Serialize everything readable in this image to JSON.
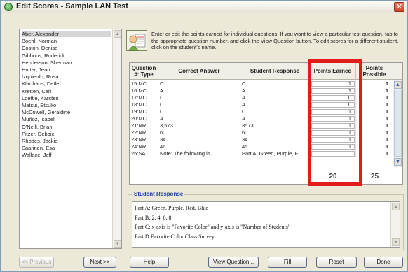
{
  "window": {
    "title": "Edit Scores - Sample LAN Test",
    "close_glyph": "✕"
  },
  "students": [
    "Aber, Alexander",
    "Boehl, Norman",
    "Coston, Denise",
    "Gibbons, Roderick",
    "Henderson, Sherman",
    "Hutter, Jean",
    "Izquierdo, Rosa",
    "Klarthaus, Detlef",
    "Kretten, Carl",
    "Loettle, Karsten",
    "Matsui, Etsuko",
    "McDowell, Geraldine",
    "Muñoz, Isabel",
    "O'Neill, Brian",
    "Pitzer, Debbie",
    "Rhodes, Jackie",
    "Saarinen, Esa",
    "Wallace, Jeff"
  ],
  "selected_student_index": 0,
  "instructions": "Enter or edit the points earned for individual questions. If you want to view a particular test question, tab to the appropriate question number, and click the View Question button. To edit scores for a different student, click on the student's name.",
  "table": {
    "headers": {
      "question": "Question #: Type",
      "correct": "Correct Answer",
      "student": "Student Response",
      "earned": "Points Earned",
      "possible": "Points Possible"
    },
    "rows": [
      {
        "q": "15:MC",
        "correct": "C",
        "student": "C",
        "earned": "1",
        "possible": "1"
      },
      {
        "q": "16:MC",
        "correct": "A",
        "student": "A",
        "earned": "1",
        "possible": "1"
      },
      {
        "q": "17:MC",
        "correct": "D",
        "student": "A",
        "earned": "0",
        "possible": "1"
      },
      {
        "q": "18:MC",
        "correct": "C",
        "student": "A",
        "earned": "0",
        "possible": "1"
      },
      {
        "q": "19:MC",
        "correct": "C",
        "student": "C",
        "earned": "1",
        "possible": "1"
      },
      {
        "q": "20:MC",
        "correct": "A",
        "student": "A",
        "earned": "1",
        "possible": "1"
      },
      {
        "q": "21:NR",
        "correct": "3,573",
        "student": "3573",
        "earned": "1",
        "possible": "1"
      },
      {
        "q": "22:NR",
        "correct": "60",
        "student": "60",
        "earned": "1",
        "possible": "1"
      },
      {
        "q": "23:NR",
        "correct": "34",
        "student": "34",
        "earned": "1",
        "possible": "1"
      },
      {
        "q": "24:NR",
        "correct": "46",
        "student": "45",
        "earned": "1",
        "possible": "1"
      },
      {
        "q": "25:SA",
        "correct": "Note: The following is ...",
        "student": "Part A: Green, Purple, F",
        "earned": "",
        "possible": "1"
      }
    ],
    "total_earned": "20",
    "total_possible": "25"
  },
  "student_response": {
    "title": "Student Response",
    "lines": [
      "Part A: Green, Purple, Red, Blue",
      "Part B: 2, 4, 6, 8",
      "Part C: x-axis is \"Favorite Color\" and y-axis is \"Number of Students\"",
      "Part D:Favorite Color Class Survey"
    ]
  },
  "buttons": {
    "previous": "<< Previous",
    "next": "Next >>",
    "help": "Help",
    "view_question": "View Question...",
    "fill": "Fill",
    "reset": "Reset",
    "done": "Done"
  },
  "colors": {
    "highlight": "#e21b1b",
    "response_title": "#1c3fa8"
  }
}
